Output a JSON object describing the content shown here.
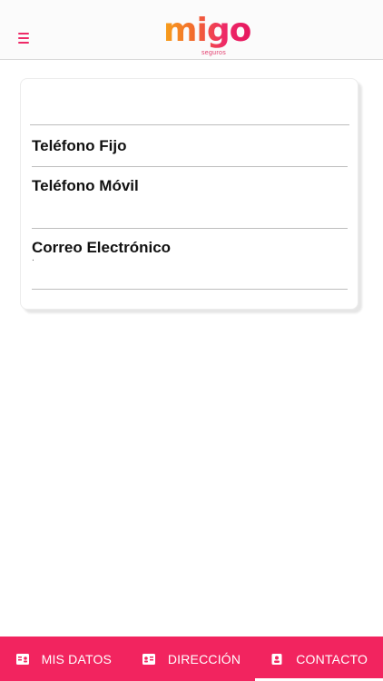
{
  "header": {
    "menu_icon": "hamburger-menu-icon",
    "logo_text": "migo",
    "logo_subtext": "seguros",
    "accent_color": "#ee2a67"
  },
  "contact": {
    "fields": [
      {
        "label": "",
        "value": ""
      },
      {
        "label": "Teléfono Fijo",
        "value": ""
      },
      {
        "label": "Teléfono Móvil",
        "value": ""
      },
      {
        "label": "Correo Electrónico",
        "value": "."
      }
    ]
  },
  "tabs": [
    {
      "label": "MIS DATOS",
      "icon": "id-card-icon",
      "active": false
    },
    {
      "label": "DIRECCIÓN",
      "icon": "address-card-icon",
      "active": false
    },
    {
      "label": "CONTACTO",
      "icon": "contact-icon",
      "active": true
    }
  ],
  "colors": {
    "tabbar": "#f2245f"
  }
}
